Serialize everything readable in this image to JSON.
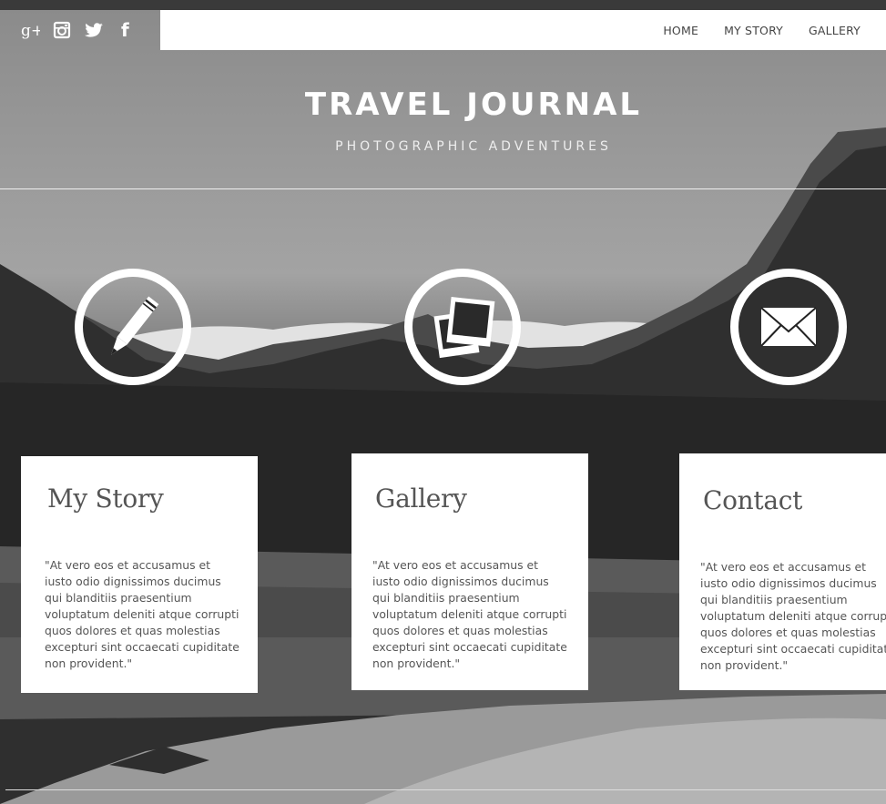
{
  "social": {
    "icons": [
      "google-plus-icon",
      "instagram-icon",
      "twitter-icon",
      "facebook-icon"
    ],
    "google_plus_glyph": "g+",
    "facebook_glyph": "f"
  },
  "nav": {
    "items": [
      {
        "label": "HOME"
      },
      {
        "label": "MY STORY"
      },
      {
        "label": "GALLERY"
      }
    ]
  },
  "header": {
    "title": "TRAVEL JOURNAL",
    "subtitle": "PHOTOGRAPHIC ADVENTURES"
  },
  "features": [
    {
      "icon": "pencil-icon",
      "title": "My Story",
      "text": "\"At vero eos et accusamus et iusto odio dignissimos ducimus qui blanditiis praesentium voluptatum deleniti atque corrupti quos dolores et quas molestias excepturi sint occaecati cupiditate non provident.\""
    },
    {
      "icon": "photos-icon",
      "title": "Gallery",
      "text": "\"At vero eos et accusamus et iusto odio dignissimos ducimus qui blanditiis praesentium voluptatum deleniti atque corrupti quos dolores et quas molestias excepturi sint occaecati cupiditate non provident.\""
    },
    {
      "icon": "envelope-icon",
      "title": "Contact",
      "text": "\"At vero eos et accusamus et iusto odio dignissimos ducimus qui blanditiis praesentium voluptatum deleniti atque corrupti quos dolores et quas molestias excepturi sint occaecati cupiditate non provident.\""
    }
  ],
  "colors": {
    "nav_background": "#ffffff",
    "nav_text": "#444444",
    "card_background": "#ffffff",
    "card_text": "#555555",
    "header_text": "#ffffff"
  }
}
